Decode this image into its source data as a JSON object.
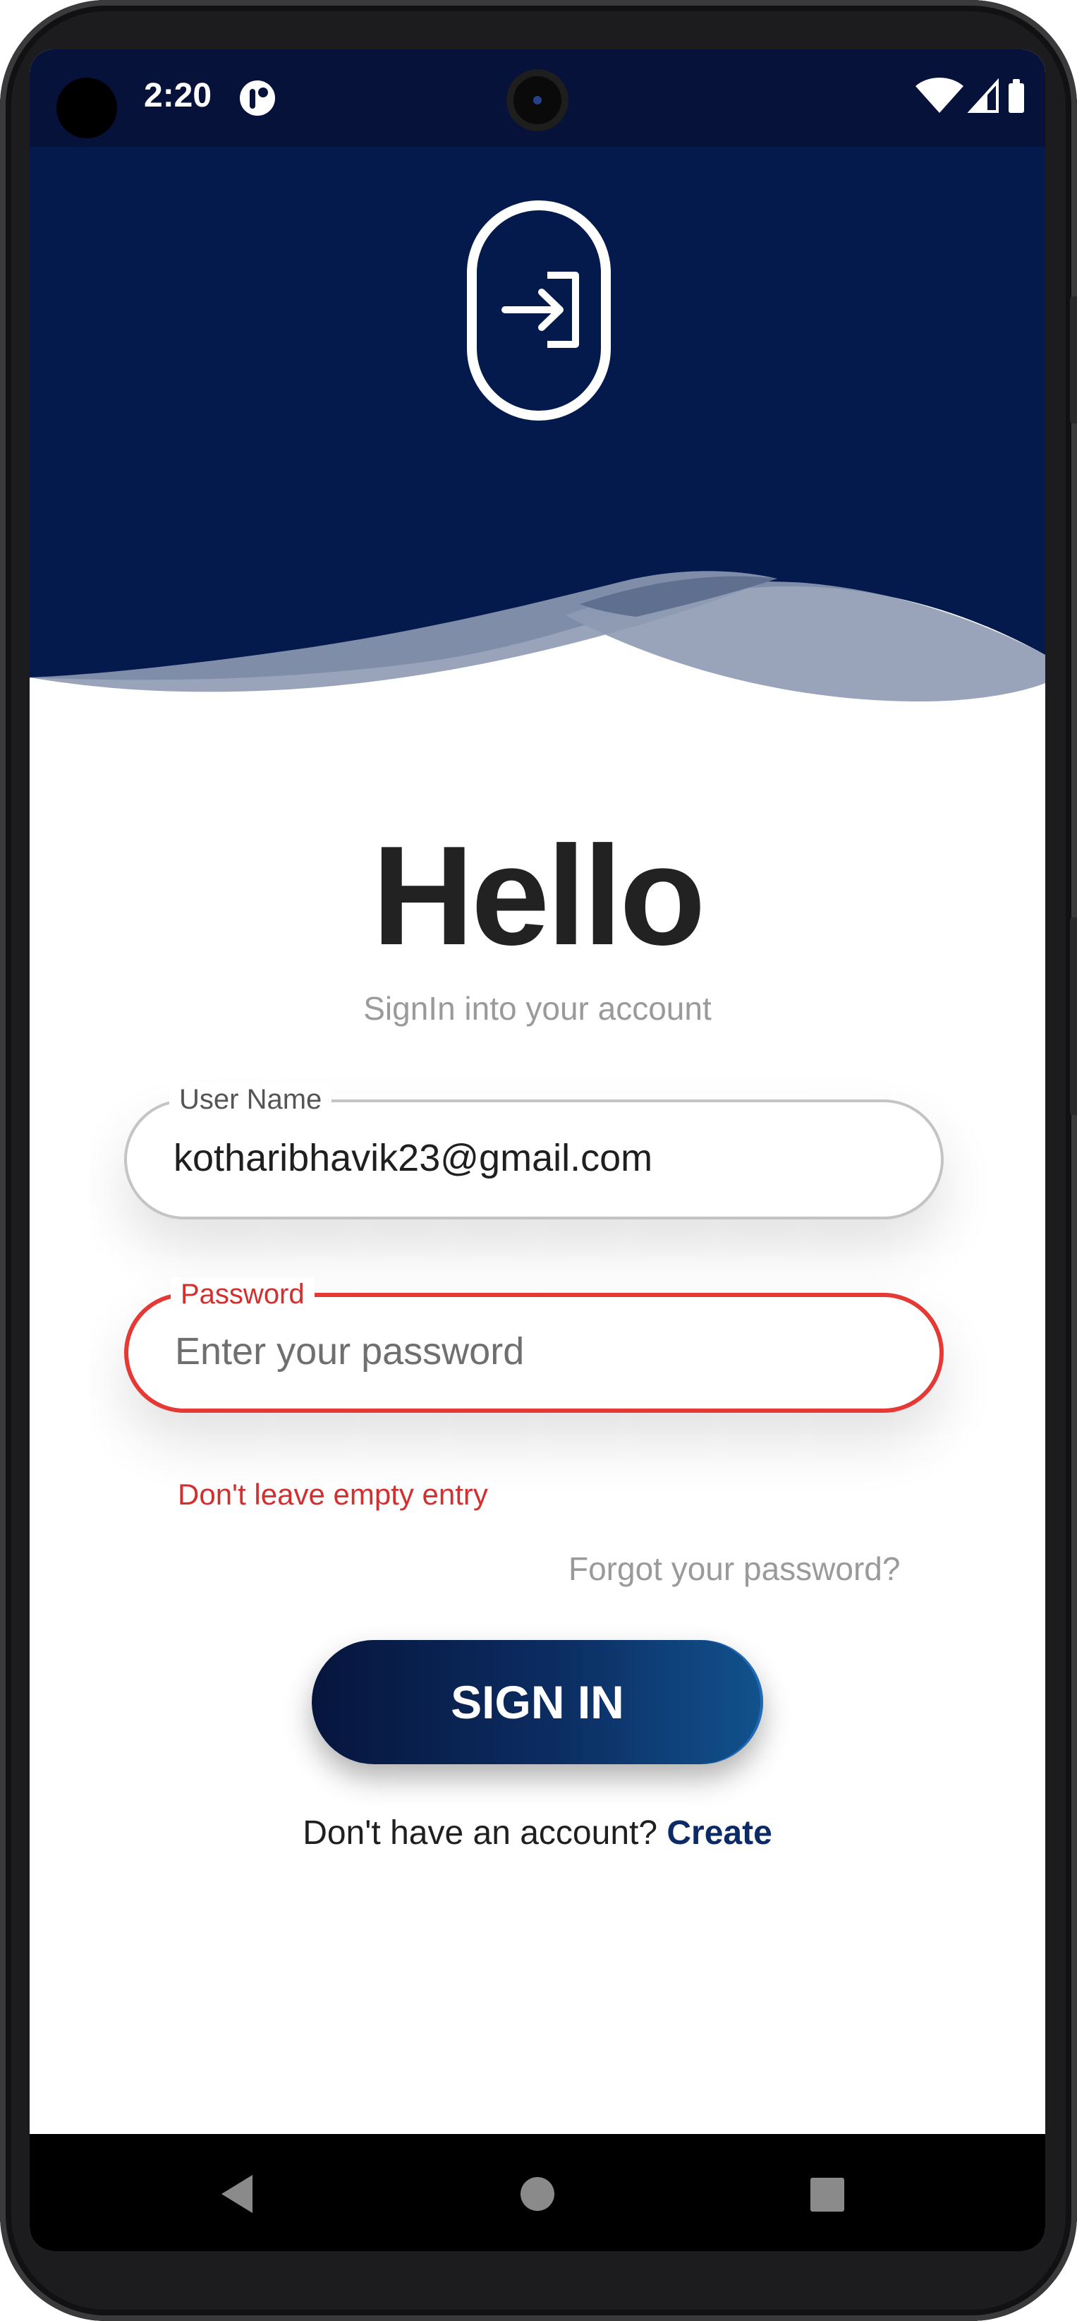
{
  "status_bar": {
    "time": "2:20",
    "icons": [
      "app-notification-icon",
      "wifi-icon",
      "cell-signal-icon",
      "battery-icon"
    ]
  },
  "header": {
    "logo_icon": "login-arrow-icon",
    "background_color": "#041a4d"
  },
  "main": {
    "title": "Hello",
    "subtitle": "SignIn into your account",
    "username": {
      "label": "User Name",
      "value": "kotharibhavik23@gmail.com"
    },
    "password": {
      "label": "Password",
      "placeholder": "Enter your password",
      "error": "Don't leave empty entry"
    },
    "forgot_password": "Forgot your password?",
    "signin_button": "SIGN IN",
    "register_prompt": "Don't have an account?",
    "register_link": "Create"
  },
  "colors": {
    "accent": "#0b2a66",
    "error": "#e53935",
    "muted_text": "#9a9a9a"
  },
  "nav_bar": {
    "icons": [
      "back-icon",
      "home-icon",
      "recents-icon"
    ]
  }
}
